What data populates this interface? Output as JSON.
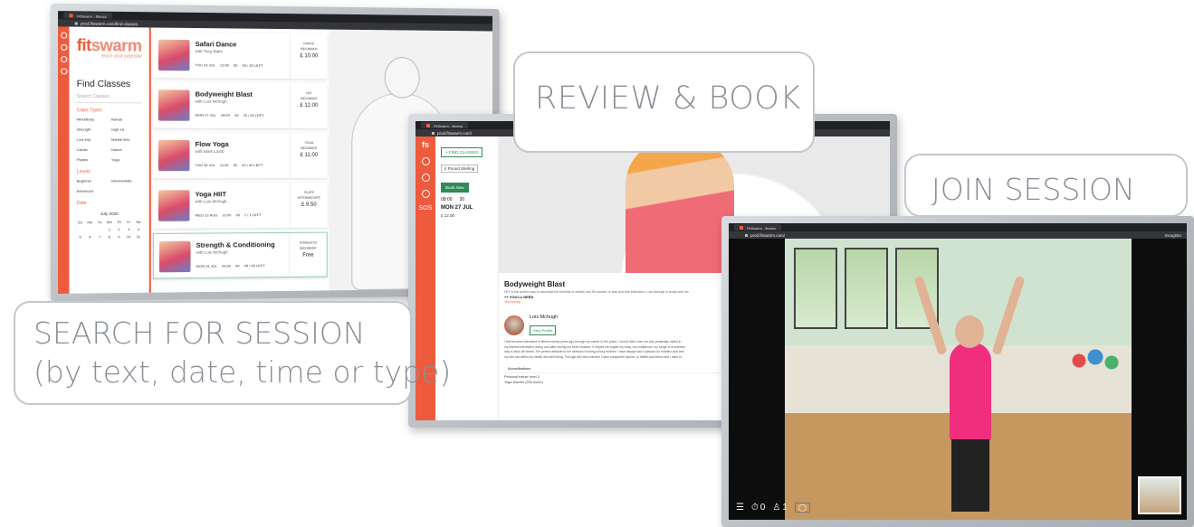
{
  "callouts": {
    "review": "REVIEW & BOOK",
    "join": "JOIN SESSION",
    "search_line1": "SEARCH FOR SESSION",
    "search_line2": "(by text, date, time or type)"
  },
  "colors": {
    "accent": "#ee5a3c",
    "green": "#2e8b57",
    "dark": "#202124"
  },
  "browser": {
    "tab_title": "FitSwarm - fitness",
    "url_search": "prod.fitswarm.com/find-classes",
    "url_review": "prod.fitswarm.com/",
    "url_join": "prod.fitswarm.com/",
    "incognito": "Incognito"
  },
  "search_screen": {
    "logo_a": "fit",
    "logo_b": "swarm",
    "tagline": "reach your potential",
    "title": "Find Classes",
    "search_placeholder": "Search Classes",
    "class_types_label": "Class Types",
    "class_types": [
      "Mind/Body",
      "Rehab",
      "Strength",
      "High Int.",
      "Low Imp",
      "Martial Arts",
      "Cardio",
      "Dance",
      "Pilates",
      "Yoga"
    ],
    "levels_label": "Levels",
    "levels": [
      "Beginner",
      "Intermediate",
      "Advanced"
    ],
    "date_label": "Date",
    "calendar_month": "July 2020",
    "calendar_days": [
      "Su",
      "Mo",
      "Tu",
      "We",
      "Th",
      "Fr",
      "Sa"
    ],
    "calendar_dates": [
      "",
      "",
      "",
      "1",
      "2",
      "3",
      "4",
      "5",
      "6",
      "7",
      "8",
      "9",
      "10",
      "11"
    ],
    "classes": [
      {
        "title": "Safari Dance",
        "instructor": "with Tony Balm",
        "date": "THU 23 JUL",
        "time": "13:00",
        "duration": "50",
        "spaces": "30 / 30 LEFT",
        "type": "DANCE",
        "level": "BEGINNER",
        "price": "£ 10.00"
      },
      {
        "title": "Bodyweight Blast",
        "instructor": "with Lois Mchugh",
        "date": "MON 27 JUL",
        "time": "08:00",
        "duration": "30",
        "spaces": "20 / 20 LEFT",
        "type": "HIIT",
        "level": "BEGINNER",
        "price": "£ 12.00"
      },
      {
        "title": "Flow Yoga",
        "instructor": "with Mark Lamb",
        "date": "THU 30 JUL",
        "time": "11:00",
        "duration": "50",
        "spaces": "40 / 40 LEFT",
        "type": "YOGA",
        "level": "BEGINNER",
        "price": "£ 11.00"
      },
      {
        "title": "Yoga HIIT",
        "instructor": "with Lois Mchugh",
        "date": "WED 12 AUG",
        "time": "12:00",
        "duration": "45",
        "spaces": "1 / 1 LEFT",
        "type": "YILATE",
        "level": "INTERMEDIATE",
        "price": "£ 9.50"
      },
      {
        "title": "Strength & Conditioning",
        "instructor": "with Lois Mchugh",
        "date": "MON 31 JUL",
        "time": "09:00",
        "duration": "40",
        "spaces": "45 / 45 LEFT",
        "type": "STRENGTH",
        "level": "BEGINNER",
        "price": "Free"
      }
    ]
  },
  "review_screen": {
    "brand": "fs",
    "sos": "SOS",
    "find_classes_btn": "+ FIND CLASSES",
    "currency": "£ Pound Sterling",
    "book_btn": "Book Now",
    "time": "08:00",
    "duration": "30",
    "date": "MON 27 JUL",
    "price": "£ 12.00",
    "class_title": "Bodyweight Blast",
    "description": "HIIT is the perfect way to maximise the benefits of activity into 30 minutes or less and Mrs Motivation, Lois Mchugh is ready with her",
    "need_label": "++ YOU'LL NEED",
    "need_item": "Your body",
    "instructor_name": "Lois Mchugh",
    "profile_btn": "View Profile",
    "bio_1": "I first became interested in fitness twenty years ago through my career in the police. I found that it was not only practically useful in",
    "bio_2": "my interest intensified during and after having my three children. It helped me regain my body, my confidence, my range of movement",
    "bio_3": "way to blow off steam. The perfect antidote to the stresses of being a busy mother! I have always had a passion for nutrition and hea",
    "bio_4": "my diet can affect my health and well being. Through diet and exercise I have conquered injuries, ill health and stress and I want to",
    "accreditations_label": "Accreditations",
    "accreditations": [
      "Personal trainer level 3",
      "Yoga teacher (200 hours)"
    ]
  },
  "join_screen": {
    "participants_timer": "0",
    "participants_count": "1"
  }
}
